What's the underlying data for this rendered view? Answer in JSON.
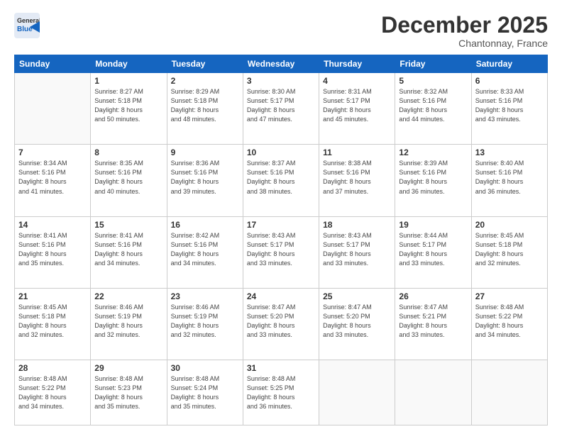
{
  "header": {
    "logo_general": "General",
    "logo_blue": "Blue",
    "month": "December 2025",
    "location": "Chantonnay, France"
  },
  "days_of_week": [
    "Sunday",
    "Monday",
    "Tuesday",
    "Wednesday",
    "Thursday",
    "Friday",
    "Saturday"
  ],
  "weeks": [
    [
      {
        "day": "",
        "info": ""
      },
      {
        "day": "1",
        "info": "Sunrise: 8:27 AM\nSunset: 5:18 PM\nDaylight: 8 hours\nand 50 minutes."
      },
      {
        "day": "2",
        "info": "Sunrise: 8:29 AM\nSunset: 5:18 PM\nDaylight: 8 hours\nand 48 minutes."
      },
      {
        "day": "3",
        "info": "Sunrise: 8:30 AM\nSunset: 5:17 PM\nDaylight: 8 hours\nand 47 minutes."
      },
      {
        "day": "4",
        "info": "Sunrise: 8:31 AM\nSunset: 5:17 PM\nDaylight: 8 hours\nand 45 minutes."
      },
      {
        "day": "5",
        "info": "Sunrise: 8:32 AM\nSunset: 5:16 PM\nDaylight: 8 hours\nand 44 minutes."
      },
      {
        "day": "6",
        "info": "Sunrise: 8:33 AM\nSunset: 5:16 PM\nDaylight: 8 hours\nand 43 minutes."
      }
    ],
    [
      {
        "day": "7",
        "info": "Sunrise: 8:34 AM\nSunset: 5:16 PM\nDaylight: 8 hours\nand 41 minutes."
      },
      {
        "day": "8",
        "info": "Sunrise: 8:35 AM\nSunset: 5:16 PM\nDaylight: 8 hours\nand 40 minutes."
      },
      {
        "day": "9",
        "info": "Sunrise: 8:36 AM\nSunset: 5:16 PM\nDaylight: 8 hours\nand 39 minutes."
      },
      {
        "day": "10",
        "info": "Sunrise: 8:37 AM\nSunset: 5:16 PM\nDaylight: 8 hours\nand 38 minutes."
      },
      {
        "day": "11",
        "info": "Sunrise: 8:38 AM\nSunset: 5:16 PM\nDaylight: 8 hours\nand 37 minutes."
      },
      {
        "day": "12",
        "info": "Sunrise: 8:39 AM\nSunset: 5:16 PM\nDaylight: 8 hours\nand 36 minutes."
      },
      {
        "day": "13",
        "info": "Sunrise: 8:40 AM\nSunset: 5:16 PM\nDaylight: 8 hours\nand 36 minutes."
      }
    ],
    [
      {
        "day": "14",
        "info": "Sunrise: 8:41 AM\nSunset: 5:16 PM\nDaylight: 8 hours\nand 35 minutes."
      },
      {
        "day": "15",
        "info": "Sunrise: 8:41 AM\nSunset: 5:16 PM\nDaylight: 8 hours\nand 34 minutes."
      },
      {
        "day": "16",
        "info": "Sunrise: 8:42 AM\nSunset: 5:16 PM\nDaylight: 8 hours\nand 34 minutes."
      },
      {
        "day": "17",
        "info": "Sunrise: 8:43 AM\nSunset: 5:17 PM\nDaylight: 8 hours\nand 33 minutes."
      },
      {
        "day": "18",
        "info": "Sunrise: 8:43 AM\nSunset: 5:17 PM\nDaylight: 8 hours\nand 33 minutes."
      },
      {
        "day": "19",
        "info": "Sunrise: 8:44 AM\nSunset: 5:17 PM\nDaylight: 8 hours\nand 33 minutes."
      },
      {
        "day": "20",
        "info": "Sunrise: 8:45 AM\nSunset: 5:18 PM\nDaylight: 8 hours\nand 32 minutes."
      }
    ],
    [
      {
        "day": "21",
        "info": "Sunrise: 8:45 AM\nSunset: 5:18 PM\nDaylight: 8 hours\nand 32 minutes."
      },
      {
        "day": "22",
        "info": "Sunrise: 8:46 AM\nSunset: 5:19 PM\nDaylight: 8 hours\nand 32 minutes."
      },
      {
        "day": "23",
        "info": "Sunrise: 8:46 AM\nSunset: 5:19 PM\nDaylight: 8 hours\nand 32 minutes."
      },
      {
        "day": "24",
        "info": "Sunrise: 8:47 AM\nSunset: 5:20 PM\nDaylight: 8 hours\nand 33 minutes."
      },
      {
        "day": "25",
        "info": "Sunrise: 8:47 AM\nSunset: 5:20 PM\nDaylight: 8 hours\nand 33 minutes."
      },
      {
        "day": "26",
        "info": "Sunrise: 8:47 AM\nSunset: 5:21 PM\nDaylight: 8 hours\nand 33 minutes."
      },
      {
        "day": "27",
        "info": "Sunrise: 8:48 AM\nSunset: 5:22 PM\nDaylight: 8 hours\nand 34 minutes."
      }
    ],
    [
      {
        "day": "28",
        "info": "Sunrise: 8:48 AM\nSunset: 5:22 PM\nDaylight: 8 hours\nand 34 minutes."
      },
      {
        "day": "29",
        "info": "Sunrise: 8:48 AM\nSunset: 5:23 PM\nDaylight: 8 hours\nand 35 minutes."
      },
      {
        "day": "30",
        "info": "Sunrise: 8:48 AM\nSunset: 5:24 PM\nDaylight: 8 hours\nand 35 minutes."
      },
      {
        "day": "31",
        "info": "Sunrise: 8:48 AM\nSunset: 5:25 PM\nDaylight: 8 hours\nand 36 minutes."
      },
      {
        "day": "",
        "info": ""
      },
      {
        "day": "",
        "info": ""
      },
      {
        "day": "",
        "info": ""
      }
    ]
  ]
}
